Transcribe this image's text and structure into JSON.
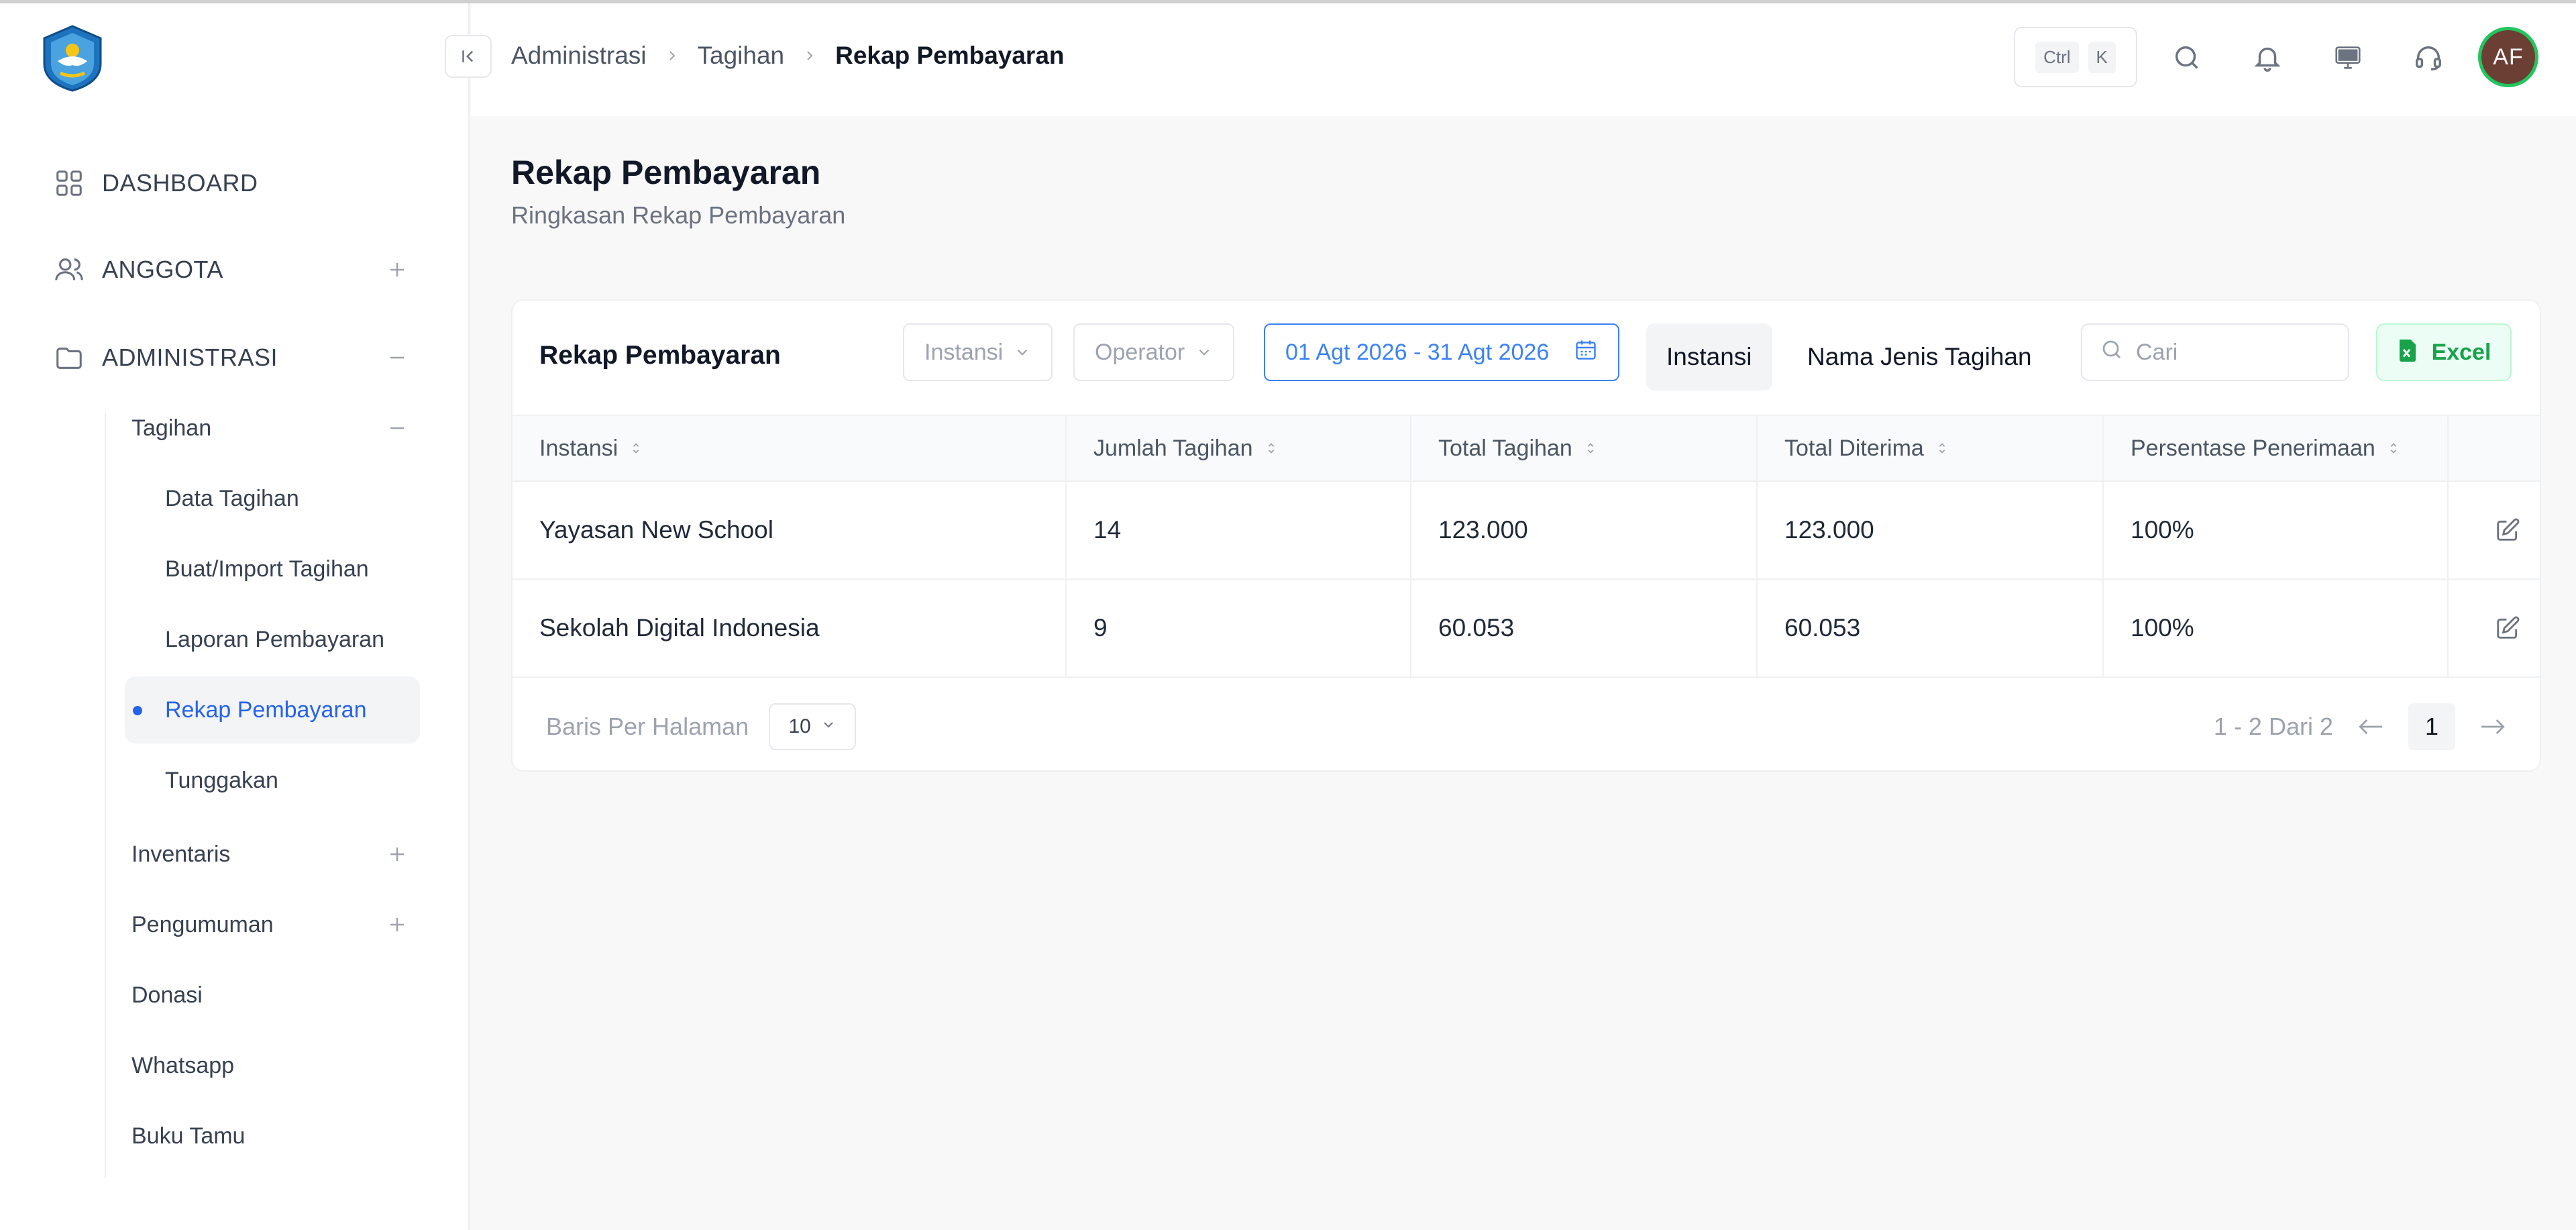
{
  "sidebar": {
    "top_items": [
      {
        "label": "DASHBOARD",
        "icon": "grid-icon"
      },
      {
        "label": "ANGGOTA",
        "icon": "users-icon"
      },
      {
        "label": "ADMINISTRASI",
        "icon": "folder-icon"
      }
    ],
    "sub_items": [
      {
        "label": "Tagihan"
      },
      {
        "label": "Inventaris"
      },
      {
        "label": "Pengumuman"
      },
      {
        "label": "Donasi"
      },
      {
        "label": "Whatsapp"
      },
      {
        "label": "Buku Tamu"
      }
    ],
    "leaf_items": [
      {
        "label": "Data Tagihan"
      },
      {
        "label": "Buat/Import Tagihan"
      },
      {
        "label": "Laporan Pembayaran"
      },
      {
        "label": "Rekap Pembayaran",
        "active": true
      },
      {
        "label": "Tunggakan"
      }
    ]
  },
  "header": {
    "breadcrumb": [
      "Administrasi",
      "Tagihan",
      "Rekap Pembayaran"
    ],
    "shortcut": {
      "key1": "Ctrl",
      "key2": "K"
    },
    "avatar_initials": "AF"
  },
  "page": {
    "title": "Rekap Pembayaran",
    "subtitle": "Ringkasan Rekap Pembayaran"
  },
  "card": {
    "title": "Rekap Pembayaran",
    "filter_instansi": "Instansi",
    "filter_operator": "Operator",
    "date_range": "01 Agt 2026 - 31 Agt 2026",
    "tab_instansi": "Instansi",
    "tab_jenis": "Nama Jenis Tagihan",
    "search_placeholder": "Cari",
    "excel_label": "Excel"
  },
  "table": {
    "headers": [
      "Instansi",
      "Jumlah Tagihan",
      "Total Tagihan",
      "Total Diterima",
      "Persentase Penerimaan"
    ],
    "rows": [
      [
        "Yayasan New School",
        "14",
        "123.000",
        "123.000",
        "100%"
      ],
      [
        "Sekolah Digital Indonesia",
        "9",
        "60.053",
        "60.053",
        "100%"
      ]
    ]
  },
  "pagination": {
    "rows_label": "Baris Per Halaman",
    "page_size": "10",
    "range_text": "1 - 2 Dari 2",
    "current_page": "1"
  },
  "colors": {
    "accent": "#2563eb",
    "excel_green": "#16a34a",
    "avatar_bg": "#6b3f33",
    "avatar_ring": "#22c55e"
  }
}
